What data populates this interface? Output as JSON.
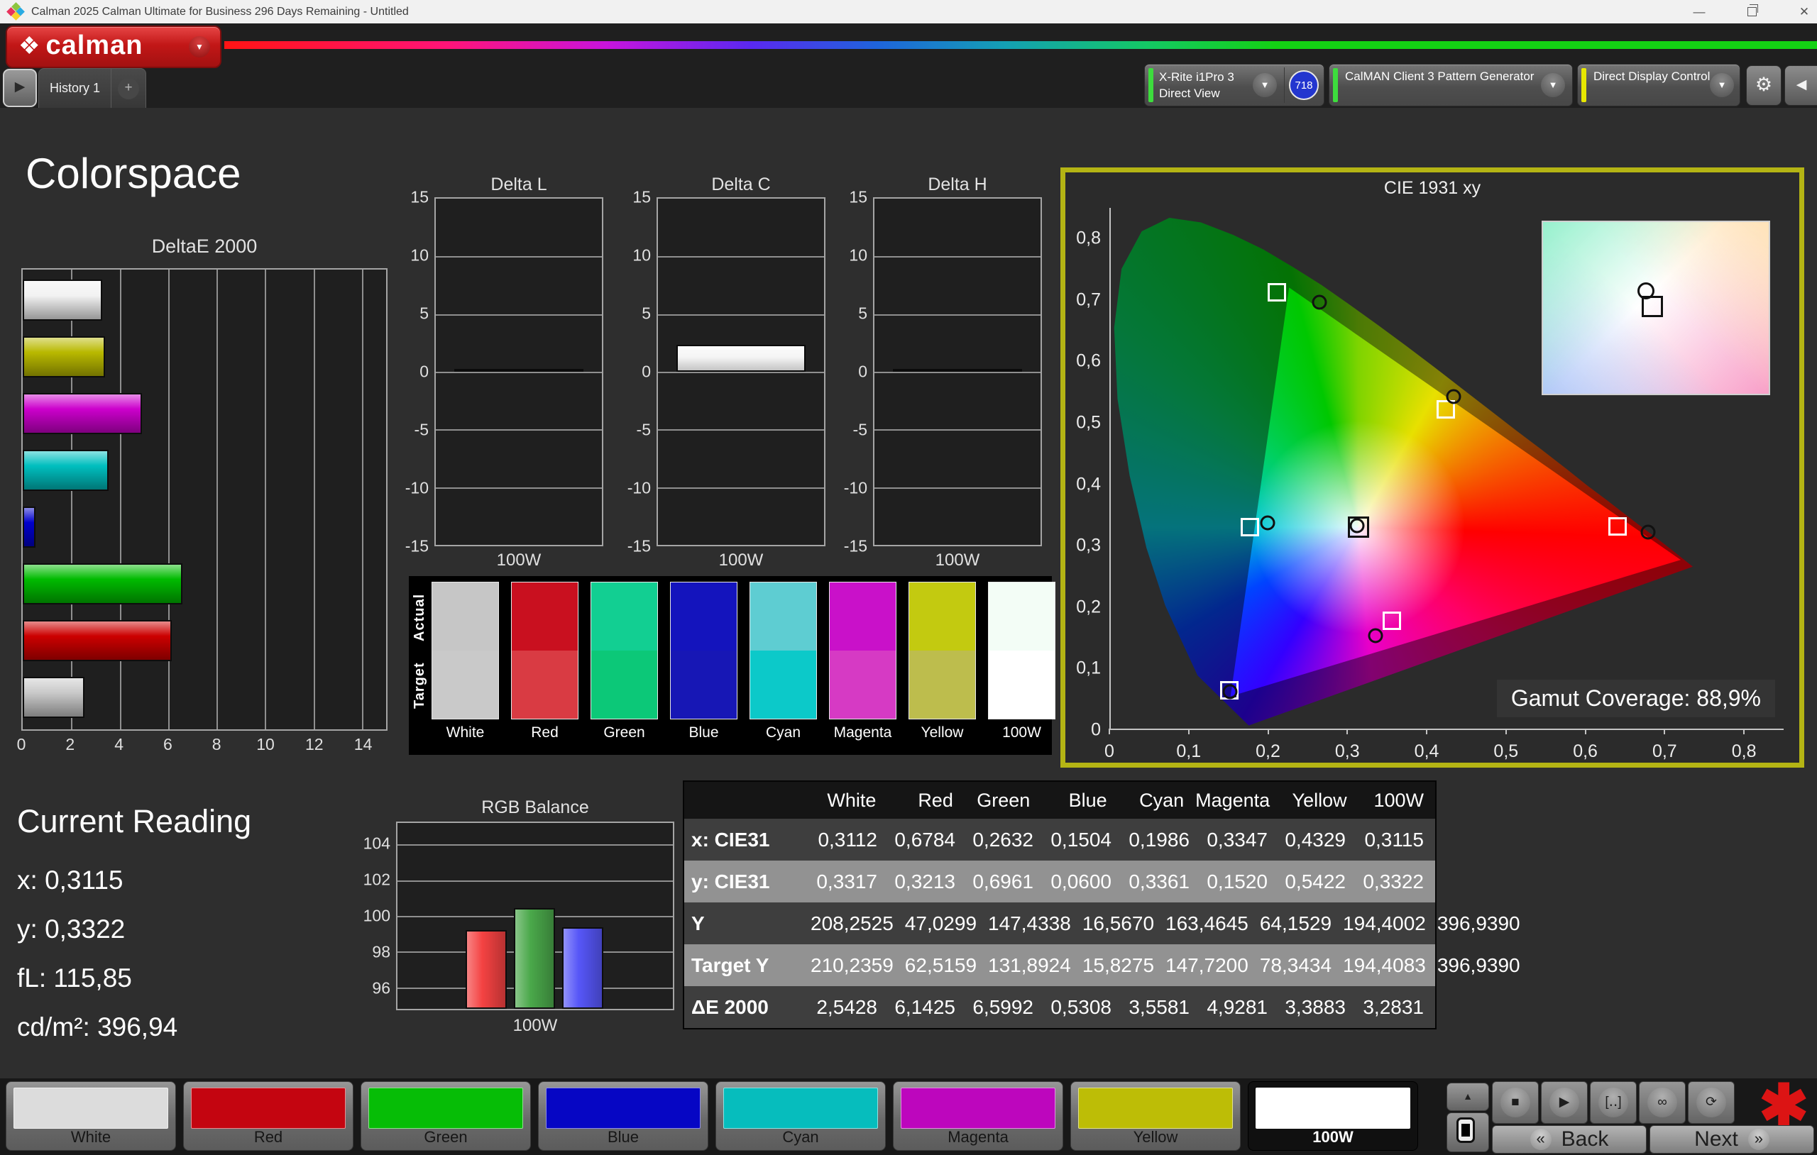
{
  "window": {
    "title": "Calman 2025 Calman Ultimate for Business 296 Days Remaining  - Untitled"
  },
  "icons": {
    "brand_mark": "❖",
    "dropdown_arrow": "▼",
    "gear": "⚙",
    "collapse": "◀",
    "tab_play": "▶",
    "up": "▲",
    "asterisk": "✱",
    "minimize": "—",
    "close": "✕",
    "back": "«",
    "next": "»",
    "plus": "+"
  },
  "toolbar": {
    "brand": "calman",
    "meter": {
      "line1": "X-Rite i1Pro 3",
      "line2": "Direct View",
      "badge": "718"
    },
    "pattern_generator": "CalMAN Client 3 Pattern Generator",
    "display_control": "Direct Display Control",
    "indicator_green": "#3ddd3d",
    "indicator_yellow": "#e8e800"
  },
  "tabs": {
    "history": "History 1"
  },
  "page": {
    "title": "Colorspace"
  },
  "chart_data": [
    {
      "id": "deltae2000",
      "type": "bar",
      "orientation": "horizontal",
      "title": "DeltaE 2000",
      "categories": [
        "100W",
        "Yellow",
        "Magenta",
        "Cyan",
        "Blue",
        "Green",
        "Red",
        "White"
      ],
      "values": [
        3.2831,
        3.3883,
        4.9281,
        3.5581,
        0.5308,
        6.5992,
        6.1425,
        2.5428
      ],
      "colors": [
        "#f2f2f2",
        "#b9b900",
        "#cc00cc",
        "#00bfbf",
        "#0000cc",
        "#00bb00",
        "#cc0000",
        "#c9c9c9"
      ],
      "xlim": [
        0,
        15
      ],
      "xticks": [
        0,
        2,
        4,
        6,
        8,
        10,
        12,
        14
      ],
      "grid": true
    },
    {
      "id": "delta_l",
      "type": "bar",
      "title": "Delta L",
      "categories": [
        "100W"
      ],
      "xlabel": "100W",
      "values": [
        0.0
      ],
      "bar_color": "#0b0b0b",
      "ylim": [
        -15,
        15
      ],
      "yticks": [
        15,
        10,
        5,
        0,
        -5,
        -10,
        -15
      ],
      "grid": true
    },
    {
      "id": "delta_c",
      "type": "bar",
      "title": "Delta C",
      "categories": [
        "100W"
      ],
      "xlabel": "100W",
      "values": [
        2.3
      ],
      "bar_color": "#f5f5f5",
      "ylim": [
        -15,
        15
      ],
      "yticks": [
        15,
        10,
        5,
        0,
        -5,
        -10,
        -15
      ],
      "grid": true
    },
    {
      "id": "delta_h",
      "type": "bar",
      "title": "Delta H",
      "categories": [
        "100W"
      ],
      "xlabel": "100W",
      "values": [
        0.0
      ],
      "bar_color": "#0b0b0b",
      "ylim": [
        -15,
        15
      ],
      "yticks": [
        15,
        10,
        5,
        0,
        -5,
        -10,
        -15
      ],
      "grid": true
    },
    {
      "id": "rgb_balance",
      "type": "bar",
      "title": "RGB Balance",
      "xlabel": "100W",
      "categories": [
        "Red",
        "Green",
        "Blue"
      ],
      "values": [
        99.2,
        100.45,
        99.35
      ],
      "colors": [
        "#f44242",
        "#4aa84a",
        "#5656f8"
      ],
      "ylim": [
        94.8,
        105.2
      ],
      "yticks": [
        96,
        98,
        100,
        102,
        104
      ],
      "grid": true
    },
    {
      "id": "cie",
      "type": "scatter",
      "title": "CIE 1931 xy",
      "xlim": [
        0,
        0.85
      ],
      "ylim": [
        0,
        0.85
      ],
      "xticks": [
        0,
        0.1,
        0.2,
        0.3,
        0.4,
        0.5,
        0.6,
        0.7,
        0.8
      ],
      "xtick_labels": [
        "0",
        "0,1",
        "0,2",
        "0,3",
        "0,4",
        "0,5",
        "0,6",
        "0,7",
        "0,8"
      ],
      "yticks": [
        0,
        0.1,
        0.2,
        0.3,
        0.4,
        0.5,
        0.6,
        0.7,
        0.8
      ],
      "ytick_labels": [
        "0",
        "0,1",
        "0,2",
        "0,3",
        "0,4",
        "0,5",
        "0,6",
        "0,7",
        "0,8"
      ],
      "gamut_coverage_label": "Gamut Coverage:",
      "gamut_coverage_value": "88,9%",
      "target_points": [
        {
          "name": "white",
          "x": 0.3127,
          "y": 0.329
        },
        {
          "name": "red",
          "x": 0.64,
          "y": 0.33
        },
        {
          "name": "green",
          "x": 0.21,
          "y": 0.712
        },
        {
          "name": "blue",
          "x": 0.15,
          "y": 0.063
        },
        {
          "name": "cyan",
          "x": 0.176,
          "y": 0.329
        },
        {
          "name": "magenta",
          "x": 0.355,
          "y": 0.176
        },
        {
          "name": "yellow",
          "x": 0.423,
          "y": 0.521
        }
      ],
      "measured_points": [
        {
          "name": "white",
          "x": 0.3112,
          "y": 0.3317
        },
        {
          "name": "red",
          "x": 0.6784,
          "y": 0.3213
        },
        {
          "name": "green",
          "x": 0.2632,
          "y": 0.6961
        },
        {
          "name": "blue",
          "x": 0.1504,
          "y": 0.06
        },
        {
          "name": "cyan",
          "x": 0.1986,
          "y": 0.3361
        },
        {
          "name": "magenta",
          "x": 0.3347,
          "y": 0.152
        },
        {
          "name": "yellow",
          "x": 0.4329,
          "y": 0.5422
        }
      ]
    }
  ],
  "swatch_panel": {
    "row_labels": [
      "Actual",
      "Target"
    ],
    "columns": [
      {
        "label": "White",
        "actual": "#c6c6c6",
        "target": "#c9c9c9"
      },
      {
        "label": "Red",
        "actual": "#c9101f",
        "target": "#d93b43"
      },
      {
        "label": "Green",
        "actual": "#12cf92",
        "target": "#0cc878"
      },
      {
        "label": "Blue",
        "actual": "#1414bd",
        "target": "#1717b5"
      },
      {
        "label": "Cyan",
        "actual": "#5ecdd2",
        "target": "#0cc9c9"
      },
      {
        "label": "Magenta",
        "actual": "#c911c9",
        "target": "#d63ac4"
      },
      {
        "label": "Yellow",
        "actual": "#c3ca10",
        "target": "#bdbd4d"
      },
      {
        "label": "100W",
        "actual": "#f3fdf6",
        "target": "#ffffff"
      }
    ]
  },
  "current_reading": {
    "title": "Current Reading",
    "lines": [
      {
        "label": "x:",
        "value": "0,3115"
      },
      {
        "label": "y:",
        "value": "0,3322"
      },
      {
        "label": "fL:",
        "value": "115,85"
      },
      {
        "label": "cd/m²:",
        "value": "396,94"
      }
    ]
  },
  "table": {
    "headers": [
      "White",
      "Red",
      "Green",
      "Blue",
      "Cyan",
      "Magenta",
      "Yellow",
      "100W"
    ],
    "rows": [
      {
        "label": "x: CIE31",
        "values": [
          "0,3112",
          "0,6784",
          "0,2632",
          "0,1504",
          "0,1986",
          "0,3347",
          "0,4329",
          "0,3115"
        ]
      },
      {
        "label": "y: CIE31",
        "values": [
          "0,3317",
          "0,3213",
          "0,6961",
          "0,0600",
          "0,3361",
          "0,1520",
          "0,5422",
          "0,3322"
        ]
      },
      {
        "label": "Y",
        "values": [
          "208,2525",
          "47,0299",
          "147,4338",
          "16,5670",
          "163,4645",
          "64,1529",
          "194,4002",
          "396,9390"
        ]
      },
      {
        "label": "Target Y",
        "values": [
          "210,2359",
          "62,5159",
          "131,8924",
          "15,8275",
          "147,7200",
          "78,3434",
          "194,4083",
          "396,9390"
        ]
      },
      {
        "label": "ΔE 2000",
        "values": [
          "2,5428",
          "6,1425",
          "6,5992",
          "0,5308",
          "3,5581",
          "4,9281",
          "3,3883",
          "3,2831"
        ]
      }
    ]
  },
  "footer": {
    "buttons": [
      {
        "label": "White",
        "color": "#dcdcdc",
        "selected": false
      },
      {
        "label": "Red",
        "color": "#c40510",
        "selected": false
      },
      {
        "label": "Green",
        "color": "#06bd06",
        "selected": false
      },
      {
        "label": "Blue",
        "color": "#0606c4",
        "selected": false
      },
      {
        "label": "Cyan",
        "color": "#06bdbd",
        "selected": false
      },
      {
        "label": "Magenta",
        "color": "#bd06bd",
        "selected": false
      },
      {
        "label": "Yellow",
        "color": "#bdbd06",
        "selected": false
      },
      {
        "label": "100W",
        "color": "#ffffff",
        "selected": true
      }
    ],
    "controls": [
      {
        "name": "stop",
        "glyph": "■"
      },
      {
        "name": "play",
        "glyph": "▶"
      },
      {
        "name": "step",
        "glyph": "[‥]"
      },
      {
        "name": "loop",
        "glyph": "∞"
      },
      {
        "name": "refresh",
        "glyph": "⟳"
      }
    ],
    "back_label": "Back",
    "next_label": "Next"
  }
}
